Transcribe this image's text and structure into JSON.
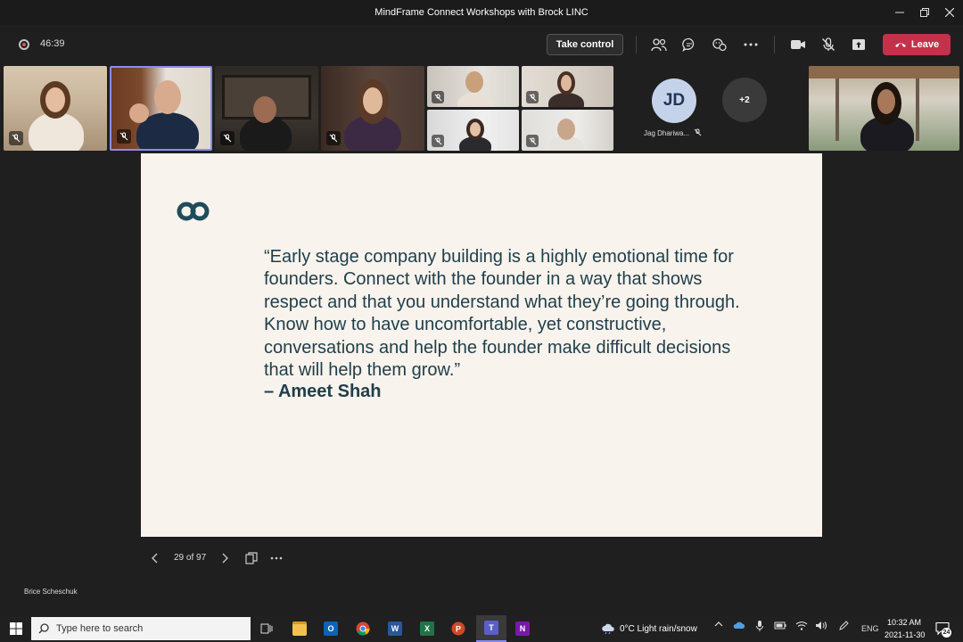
{
  "window": {
    "title": "MindFrame Connect Workshops with Brock LINC"
  },
  "toolbar": {
    "timer": "46:39",
    "take_control_label": "Take control",
    "leave_label": "Leave"
  },
  "participants": {
    "jd_initials": "JD",
    "jd_name": "Jag Dhariwa...",
    "more_count": "+2"
  },
  "slide": {
    "quote": "“Early stage company building is a highly emotional time for founders. Connect with the founder in a way that shows respect and that you understand what they’re going through. Know how to have uncomfortable, yet constructive, conversations and help the founder make difficult decisions that will help them grow.”",
    "author": "– Ameet Shah",
    "counter": "29 of 97"
  },
  "presenter_name": "Brice Scheschuk",
  "taskbar": {
    "search_placeholder": "Type here to search",
    "weather": "0°C  Light rain/snow",
    "language": "ENG",
    "time": "10:32 AM",
    "date": "2021-11-30",
    "notification_count": "24"
  },
  "colors": {
    "leave": "#c4314b",
    "slide_bg": "#f8f3ec",
    "slide_text": "#1f3e4b",
    "active_speaker_border": "#8b8cf0"
  }
}
